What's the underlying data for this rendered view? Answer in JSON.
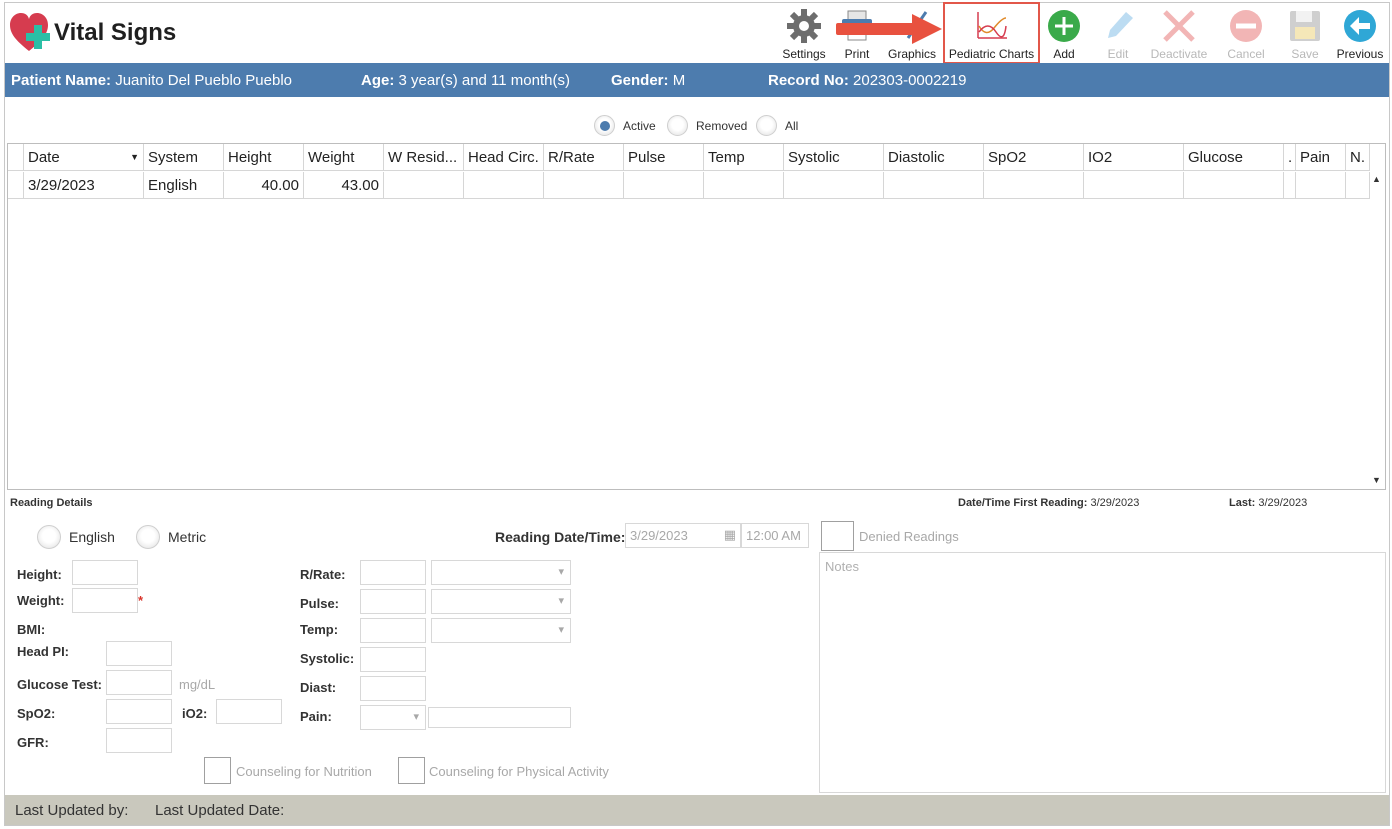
{
  "app": {
    "title": "Vital Signs"
  },
  "toolbar": [
    {
      "id": "settings",
      "label": "Settings",
      "icon": "gear-icon",
      "enabled": true
    },
    {
      "id": "print",
      "label": "Print",
      "icon": "printer-icon",
      "enabled": true
    },
    {
      "id": "graphics",
      "label": "Graphics",
      "icon": "graphics-icon",
      "enabled": true
    },
    {
      "id": "pediatric",
      "label": "Pediatric Charts",
      "icon": "growth-chart-icon",
      "enabled": true
    },
    {
      "id": "add",
      "label": "Add",
      "icon": "plus-circle-icon",
      "enabled": true
    },
    {
      "id": "edit",
      "label": "Edit",
      "icon": "pencil-icon",
      "enabled": false
    },
    {
      "id": "deactivate",
      "label": "Deactivate",
      "icon": "x-icon",
      "enabled": false
    },
    {
      "id": "cancel",
      "label": "Cancel",
      "icon": "minus-circle-icon",
      "enabled": false
    },
    {
      "id": "save",
      "label": "Save",
      "icon": "floppy-icon",
      "enabled": false
    },
    {
      "id": "previous",
      "label": "Previous",
      "icon": "arrow-left-circle-icon",
      "enabled": true
    }
  ],
  "patient": {
    "name_label": "Patient Name:",
    "name": "Juanito Del Pueblo Pueblo",
    "age_label": "Age:",
    "age": "3 year(s) and 11 month(s)",
    "gender_label": "Gender:",
    "gender": "M",
    "record_label": "Record No:",
    "record": "202303-0002219"
  },
  "filter": {
    "options": [
      "Active",
      "Removed",
      "All"
    ],
    "selected": "Active"
  },
  "grid": {
    "columns": [
      "Date",
      "System",
      "Height",
      "Weight",
      "W Resid...",
      "Head Circ.",
      "R/Rate",
      "Pulse",
      "Temp",
      "Systolic",
      "Diastolic",
      "SpO2",
      "IO2",
      "Glucose",
      ".",
      "Pain",
      "N."
    ],
    "rows": [
      [
        "3/29/2023",
        "English",
        "40.00",
        "43.00",
        "",
        "",
        "",
        "",
        "",
        "",
        "",
        "",
        "",
        "",
        "",
        "",
        ""
      ]
    ]
  },
  "details": {
    "section_label": "Reading Details",
    "first_reading_label": "Date/Time First Reading:",
    "first_reading": "3/29/2023",
    "last_label": "Last:",
    "last": "3/29/2023",
    "system_options": [
      "English",
      "Metric"
    ],
    "reading_dt_label": "Reading Date/Time:",
    "reading_date": "3/29/2023",
    "reading_time": "12:00 AM",
    "denied_label": "Denied Readings",
    "notes_placeholder": "Notes",
    "left_labels": {
      "height": "Height:",
      "weight": "Weight:",
      "bmi": "BMI:",
      "head": "Head PI:",
      "glucose": "Glucose Test:",
      "glucose_unit": "mg/dL",
      "spo2": "SpO2:",
      "io2": "iO2:",
      "gfr": "GFR:"
    },
    "mid_labels": {
      "rrate": "R/Rate:",
      "pulse": "Pulse:",
      "temp": "Temp:",
      "systolic": "Systolic:",
      "diast": "Diast:",
      "pain": "Pain:"
    },
    "required_mark": "*",
    "counsel_nutrition": "Counseling for Nutrition",
    "counsel_activity": "Counseling for Physical Activity"
  },
  "footer": {
    "updated_by": "Last Updated by:",
    "updated_date": "Last Updated Date:"
  },
  "colors": {
    "header_bar": "#4d7cae",
    "highlight": "#e2574a",
    "footer": "#c9c8bd"
  }
}
